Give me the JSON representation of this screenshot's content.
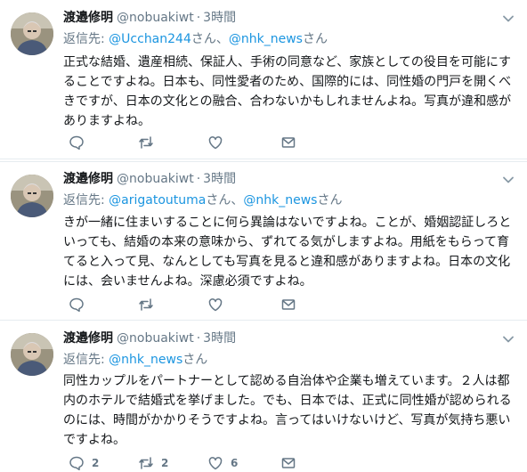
{
  "tweets": [
    {
      "name": "渡邉修明",
      "handle": "@nobuakiwt",
      "dot": "·",
      "time": "3時間",
      "reply_prefix": "返信先: ",
      "mentions": [
        "@Ucchan244",
        "@nhk_news"
      ],
      "sep1": "さん、",
      "sep2": "さん",
      "text": "正式な結婚、遺産相続、保証人、手術の同意など、家族としての役目を可能にすることですよね。日本も、同性愛者のため、国際的には、同性婚の門戸を開くべきですが、日本の文化との融合、合わないかもしれませんよね。写真が違和感がありますよね。",
      "reply_count": "",
      "retweet_count": "",
      "like_count": ""
    },
    {
      "name": "渡邉修明",
      "handle": "@nobuakiwt",
      "dot": "·",
      "time": "3時間",
      "reply_prefix": "返信先: ",
      "mentions": [
        "@arigatoutuma",
        "@nhk_news"
      ],
      "sep1": "さん、",
      "sep2": "さん",
      "text": "きが一緒に住まいすることに何ら異論はないですよね。ことが、婚姻認証しろといっても、結婚の本来の意味から、ずれてる気がしますよね。用紙をもらって育てると入って見、なんとしても写真を見ると違和感がありますよね。日本の文化には、会いませんよね。深慮必須ですよね。",
      "reply_count": "",
      "retweet_count": "",
      "like_count": ""
    },
    {
      "name": "渡邉修明",
      "handle": "@nobuakiwt",
      "dot": "·",
      "time": "3時間",
      "reply_prefix": "返信先: ",
      "mentions": [
        "@nhk_news"
      ],
      "sep1": "さん",
      "text": "同性カップルをパートナーとして認める自治体や企業も増えています。２人は都内のホテルで結婚式を挙げました。でも、日本では、正式に同性婚が認められるのには、時間がかかりそうですよね。言ってはいけないけど、写真が気持ち悪いですよね。",
      "reply_count": "2",
      "retweet_count": "2",
      "like_count": "6"
    }
  ],
  "colors": {
    "link": "#1b95e0",
    "muted": "#657786",
    "text": "#14171a",
    "separator": "#e6ecf0"
  },
  "icons": [
    "chevron-down-icon",
    "reply-icon",
    "retweet-icon",
    "like-icon",
    "message-icon"
  ]
}
